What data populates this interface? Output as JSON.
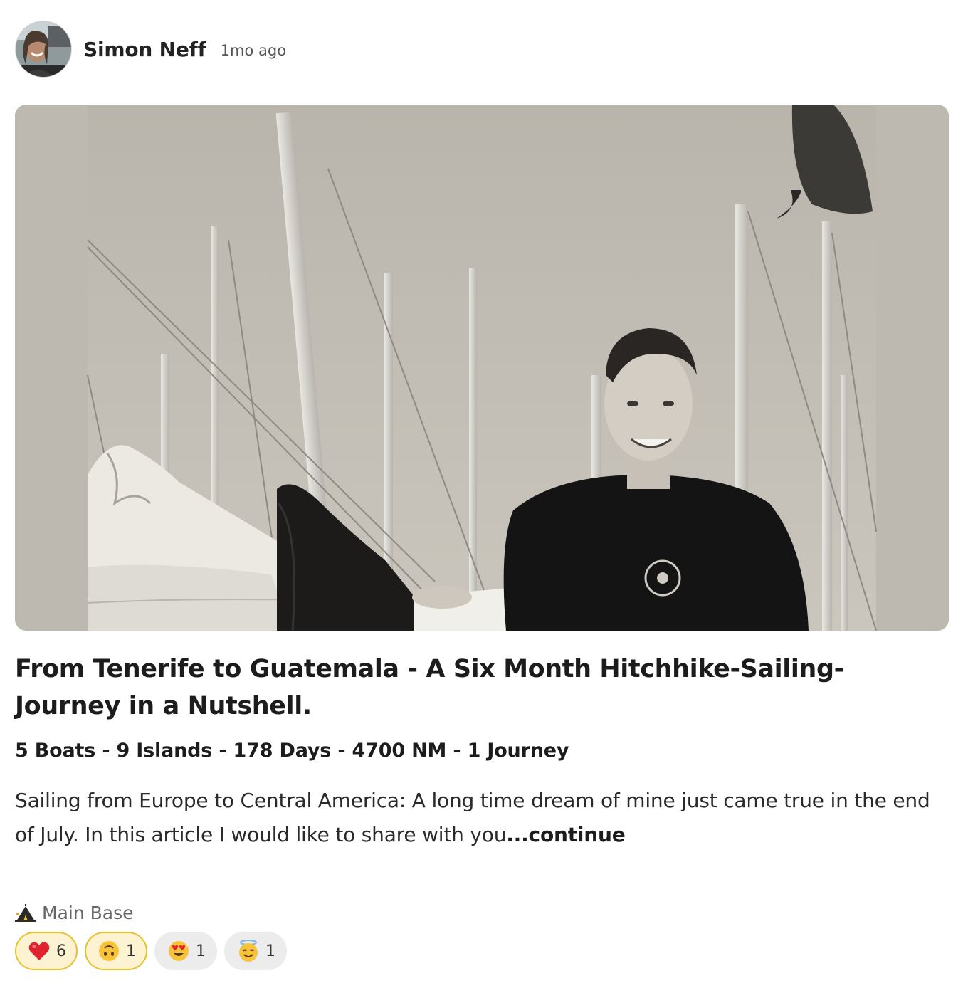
{
  "post": {
    "author": "Simon Neff",
    "time": "1mo ago",
    "title": "From Tenerife to Guatemala - A Six Month Hitchhike-Sailing-Journey in a Nutshell.",
    "subtitle": "5 Boats - 9 Islands - 178 Days - 4700 NM - 1 Journey",
    "excerpt": "Sailing from Europe to Central America: A long time dream of mine just came true in the end of July. In this article I would like to share with you",
    "continue_label": "...continue",
    "community": {
      "icon": "tent-icon",
      "label": "Main Base"
    },
    "reactions": [
      {
        "emoji": "heart",
        "count": "6",
        "active": true
      },
      {
        "emoji": "upside-down-face",
        "count": "1",
        "active": true
      },
      {
        "emoji": "heart-eyes-face",
        "count": "1",
        "active": false
      },
      {
        "emoji": "halo-face",
        "count": "1",
        "active": false
      }
    ]
  },
  "colors": {
    "active_reaction_bg": "#fdf3d3",
    "active_reaction_border": "#e8c030",
    "inactive_reaction_bg": "#ececec",
    "text": "#1c1c1c",
    "muted": "#666666"
  }
}
